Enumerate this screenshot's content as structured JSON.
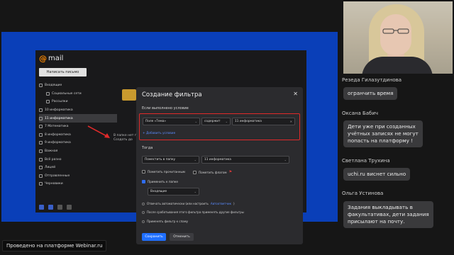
{
  "shared_screen": {
    "mail_app": {
      "logo_text": "mail",
      "compose_label": "Написать письмо",
      "folders": [
        {
          "label": "Входящие",
          "sub": false,
          "active": false
        },
        {
          "label": "Социальные сети",
          "sub": true,
          "active": false
        },
        {
          "label": "Рассылки",
          "sub": true,
          "active": false
        },
        {
          "label": "10 информатика",
          "sub": false,
          "active": false
        },
        {
          "label": "11 информатика",
          "sub": false,
          "active": true
        },
        {
          "label": "7 Математика",
          "sub": false,
          "active": false
        },
        {
          "label": "8 информатика",
          "sub": false,
          "active": false
        },
        {
          "label": "9 информатика",
          "sub": false,
          "active": false
        },
        {
          "label": "Важная",
          "sub": false,
          "active": false
        },
        {
          "label": "Всё разно",
          "sub": false,
          "active": false
        },
        {
          "label": "Лицей",
          "sub": false,
          "active": false
        },
        {
          "label": "Отправленные",
          "sub": false,
          "active": false
        },
        {
          "label": "Черновики",
          "sub": false,
          "active": false
        }
      ],
      "empty_text_line1": "В папке нет п",
      "empty_text_line2": "Создать до"
    },
    "filter_dialog": {
      "title": "Создание фильтра",
      "condition_heading": "Если выполнено условие",
      "field_select": "Поле «Тема»",
      "operator_select": "содержит",
      "value_input": "11 информатика",
      "add_condition": "Добавить условие",
      "then_heading": "Тогда",
      "action_select": "Поместить в папку",
      "folder_select": "11 информатика",
      "mark_read": "Пометить прочитанным",
      "mark_flag": "Пометить флагом",
      "apply_to_folder": "Применить к папке",
      "apply_folder_select": "Входящие",
      "auto_reply_prefix": "Отвечать автоматически (или настроить ",
      "auto_reply_link": "Автоответчик",
      "auto_reply_suffix": ")",
      "stop_other_filters": "После срабатывания этого фильтра применять другие фильтры",
      "apply_to_spam": "Применять фильтр к спаму",
      "save_label": "Сохранить",
      "cancel_label": "Отменить"
    }
  },
  "chat": {
    "messages": [
      {
        "author": "Резеда Гилазутдинова",
        "text": "огранчить время"
      },
      {
        "author": "Оксана Бабич",
        "text_lines": [
          "Дети уже при созданных",
          "учётных записях не могут",
          "попасть на платформу !"
        ]
      },
      {
        "author": "Светлана Трухина",
        "text": "uchi.ru  виснет сильно"
      },
      {
        "author": "Ольга Устинова",
        "text_lines": [
          "Задания выкладывать в",
          "факультативах, дети задания",
          "присылают на почту."
        ]
      }
    ]
  },
  "footer": {
    "text": "Проведено на платформе Webinar.ru"
  },
  "colors": {
    "screen_bg": "#0a3fb8",
    "highlight": "#e02a2a",
    "accent": "#1f6fff"
  }
}
